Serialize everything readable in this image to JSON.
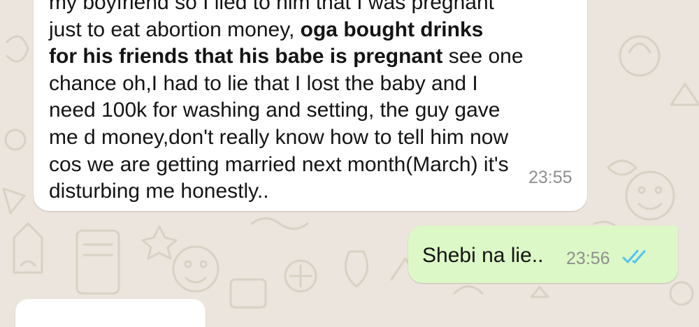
{
  "chat": {
    "incoming": {
      "lines": [
        "my boyfriend so I lied to him that I was pregnant",
        "just to eat abortion money, ",
        "oga bought drinks",
        "for his friends that his babe is pregnant",
        " see one",
        "chance oh,I had to lie that I lost the baby and I",
        "need 100k for washing and setting, the guy gave",
        "me d money,don't really know how to tell him now",
        "cos we are getting married next month(March) it's",
        "disturbing me honestly.."
      ],
      "time": "23:55"
    },
    "outgoing": {
      "text": "Shebi na lie..",
      "time": "23:56",
      "status": "read",
      "status_icon": "double-check-icon",
      "status_color": "#4fc3f7"
    }
  },
  "colors": {
    "wallpaper": "#ece5dd",
    "incoming_bubble": "#ffffff",
    "outgoing_bubble": "#dcf8c6"
  }
}
